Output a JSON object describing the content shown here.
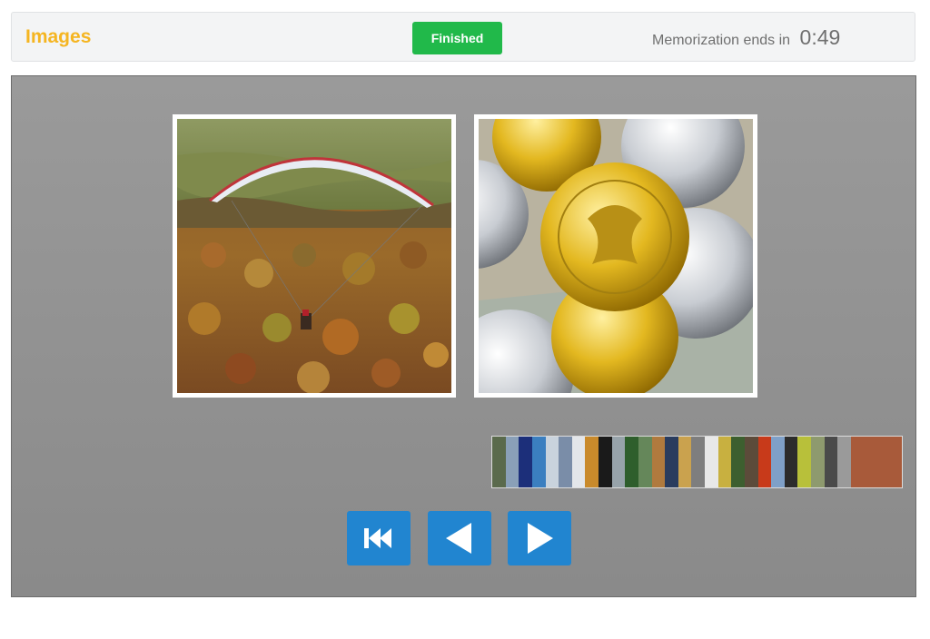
{
  "header": {
    "title": "Images",
    "finished_label": "Finished",
    "timer_label": "Memorization ends in",
    "timer_value": "0:49"
  },
  "images": [
    {
      "name": "paraglider-over-autumn-forest"
    },
    {
      "name": "gold-and-silver-coins-on-map"
    }
  ],
  "colors": {
    "title": "#f5b521",
    "finished": "#21b94a",
    "nav": "#2185d0",
    "stage": "#919191"
  },
  "thumbnails": [
    "#5a6a4c",
    "#8aa0b8",
    "#1c2f7a",
    "#3b7fc0",
    "#c9d3dd",
    "#7a8da8",
    "#e3e6ea",
    "#c98a2b",
    "#1a1a1a",
    "#97a3aa",
    "#2e5e2c",
    "#65875a",
    "#b07a3e",
    "#2a3c5e",
    "#caa24e",
    "#7e7e7e",
    "#e8e8e8",
    "#c8b040",
    "#3d5f2f",
    "#5c4b3a",
    "#c83a1a",
    "#7fa0c8",
    "#2c2c2c",
    "#b8c03a",
    "#8e9a6e",
    "#4a4a4a",
    "#9a9a9a",
    "#a85a3a"
  ],
  "nav": {
    "first_icon": "skip-back-icon",
    "prev_icon": "triangle-left-icon",
    "next_icon": "triangle-right-icon"
  }
}
